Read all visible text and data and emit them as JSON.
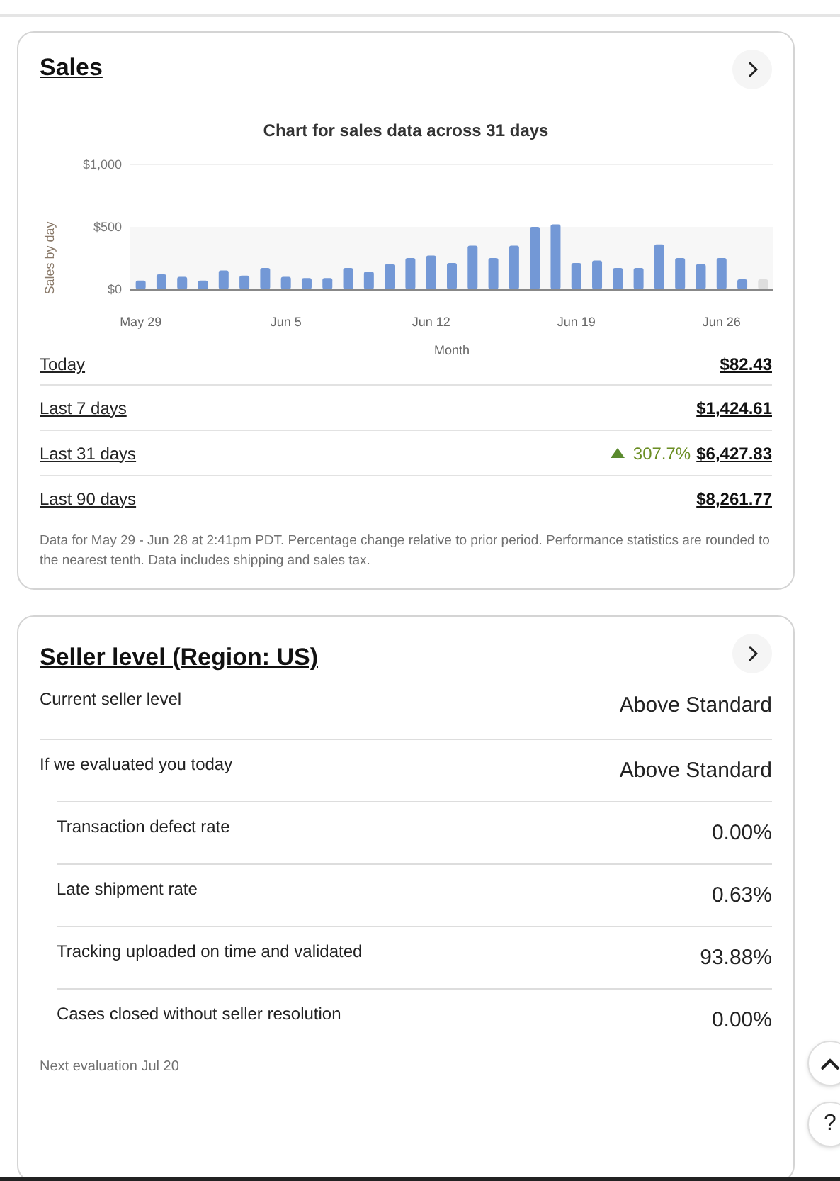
{
  "sales": {
    "title": "Sales",
    "chart": {
      "chart_data": {
        "type": "bar",
        "title": "Chart for sales data across 31 days",
        "xlabel": "Month",
        "ylabel": "Sales by day",
        "categories": [
          "May 29",
          null,
          null,
          null,
          null,
          null,
          null,
          "Jun 5",
          null,
          null,
          null,
          null,
          null,
          null,
          "Jun 12",
          null,
          null,
          null,
          null,
          null,
          null,
          "Jun 19",
          null,
          null,
          null,
          null,
          null,
          null,
          "Jun 26",
          null,
          null
        ],
        "series": [
          {
            "color": "#7398d6",
            "values": [
              70,
              120,
              100,
              70,
              150,
              110,
              170,
              100,
              90,
              90,
              170,
              140,
              200,
              250,
              270,
              210,
              350,
              250,
              350,
              500,
              520,
              210,
              230,
              170,
              170,
              360,
              250,
              200,
              250,
              80,
              null
            ]
          },
          {
            "color": "#dedede",
            "values": [
              null,
              null,
              null,
              null,
              null,
              null,
              null,
              null,
              null,
              null,
              null,
              null,
              null,
              null,
              null,
              null,
              null,
              null,
              null,
              null,
              null,
              null,
              null,
              null,
              null,
              null,
              null,
              null,
              null,
              null,
              80
            ]
          }
        ],
        "ylim": [
          0,
          1000
        ],
        "yticks": [
          {
            "value": 0,
            "label": "$0"
          },
          {
            "value": 500,
            "label": "$500"
          },
          {
            "value": 1000,
            "label": "$1,000"
          }
        ]
      }
    },
    "rows": [
      {
        "label": "Today",
        "value": "$82.43"
      },
      {
        "label": "Last 7 days",
        "value": "$1,424.61"
      },
      {
        "label": "Last 31 days",
        "value": "$6,427.83",
        "change": "307.7%"
      },
      {
        "label": "Last 90 days",
        "value": "$8,261.77"
      }
    ],
    "note": "Data for May 29 - Jun 28 at 2:41pm PDT. Percentage change relative to prior period. Performance statistics are rounded to the nearest tenth. Data includes shipping and sales tax."
  },
  "seller_level": {
    "title": "Seller level (Region: US)",
    "rows": [
      {
        "label": "Current seller level",
        "value": "Above Standard"
      },
      {
        "label": "If we evaluated you today",
        "value": "Above Standard",
        "children": [
          {
            "label": "Transaction defect rate",
            "value": "0.00%"
          },
          {
            "label": "Late shipment rate",
            "value": "0.63%"
          },
          {
            "label": "Tracking uploaded on time and validated",
            "value": "93.88%"
          },
          {
            "label": "Cases closed without seller resolution",
            "value": "0.00%"
          }
        ]
      }
    ],
    "note": "Next evaluation Jul 20"
  },
  "floating_buttons": [
    {
      "kind": "scroll-top"
    },
    {
      "kind": "help",
      "label": "?"
    }
  ]
}
